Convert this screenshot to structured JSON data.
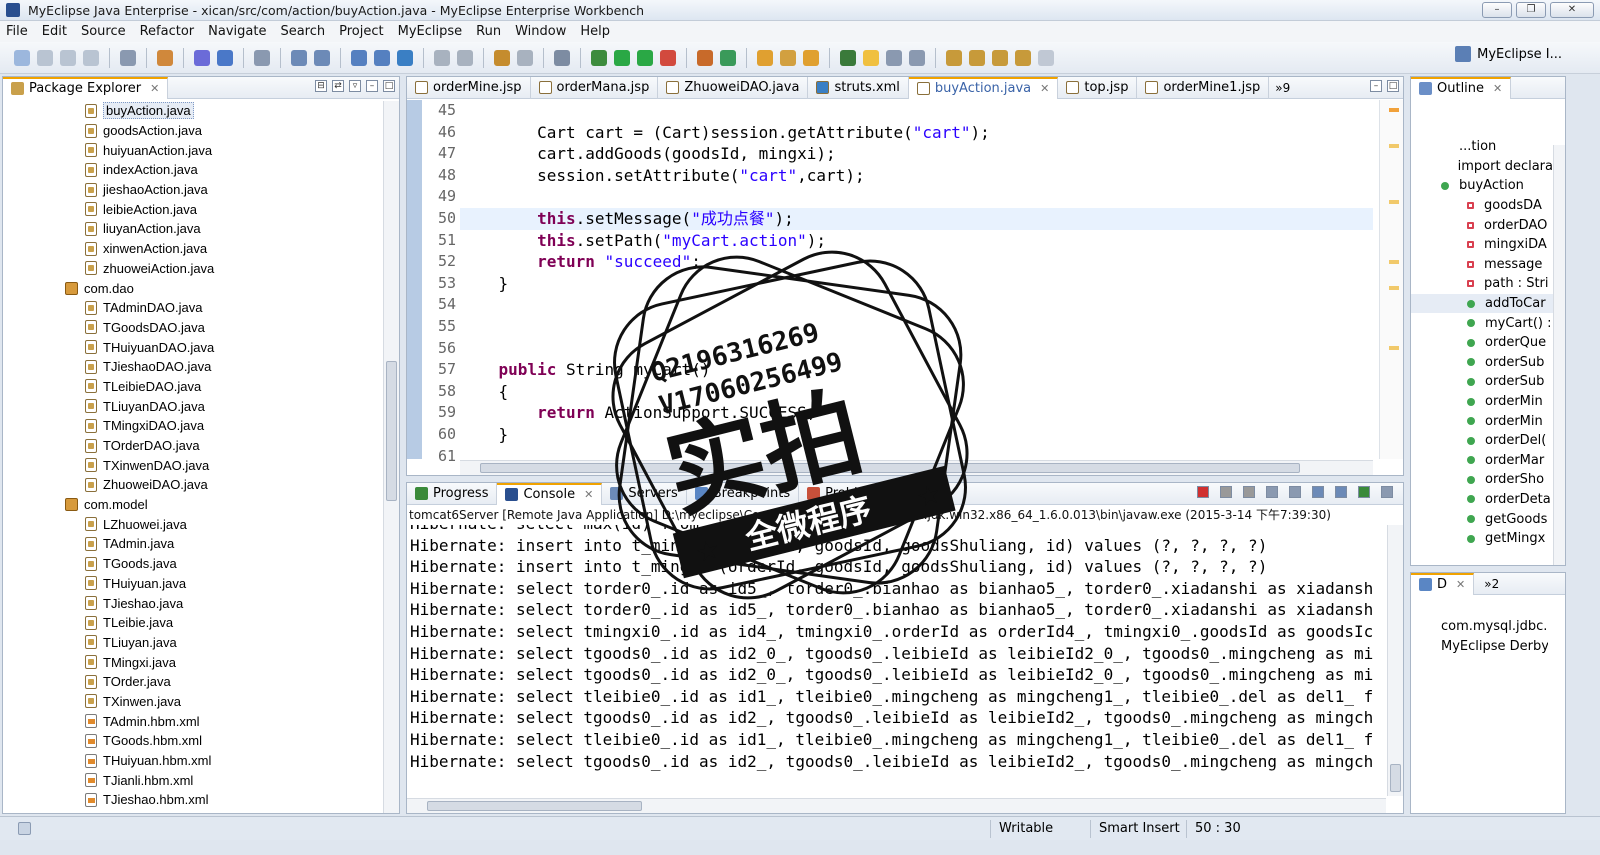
{
  "window": {
    "title": "MyEclipse Java Enterprise - xican/src/com/action/buyAction.java - MyEclipse Enterprise Workbench"
  },
  "menu": [
    "File",
    "Edit",
    "Source",
    "Refactor",
    "Navigate",
    "Search",
    "Project",
    "MyEclipse",
    "Run",
    "Window",
    "Help"
  ],
  "perspective": {
    "label": "MyEclipse I..."
  },
  "package_explorer": {
    "title": "Package Explorer",
    "items": [
      {
        "label": "buyAction.java",
        "type": "java",
        "indent": 2,
        "selected": true
      },
      {
        "label": "goodsAction.java",
        "type": "java",
        "indent": 2
      },
      {
        "label": "huiyuanAction.java",
        "type": "java",
        "indent": 2
      },
      {
        "label": "indexAction.java",
        "type": "java",
        "indent": 2
      },
      {
        "label": "jieshaoAction.java",
        "type": "java",
        "indent": 2
      },
      {
        "label": "leibieAction.java",
        "type": "java",
        "indent": 2
      },
      {
        "label": "liuyanAction.java",
        "type": "java",
        "indent": 2
      },
      {
        "label": "xinwenAction.java",
        "type": "java",
        "indent": 2
      },
      {
        "label": "zhuoweiAction.java",
        "type": "java",
        "indent": 2
      },
      {
        "label": "com.dao",
        "type": "pkg",
        "indent": 1
      },
      {
        "label": "TAdminDAO.java",
        "type": "java",
        "indent": 2
      },
      {
        "label": "TGoodsDAO.java",
        "type": "java",
        "indent": 2
      },
      {
        "label": "THuiyuanDAO.java",
        "type": "java",
        "indent": 2
      },
      {
        "label": "TJieshaoDAO.java",
        "type": "java",
        "indent": 2
      },
      {
        "label": "TLeibieDAO.java",
        "type": "java",
        "indent": 2
      },
      {
        "label": "TLiuyanDAO.java",
        "type": "java",
        "indent": 2
      },
      {
        "label": "TMingxiDAO.java",
        "type": "java",
        "indent": 2
      },
      {
        "label": "TOrderDAO.java",
        "type": "java",
        "indent": 2
      },
      {
        "label": "TXinwenDAO.java",
        "type": "java",
        "indent": 2
      },
      {
        "label": "ZhuoweiDAO.java",
        "type": "java",
        "indent": 2
      },
      {
        "label": "com.model",
        "type": "pkg",
        "indent": 1
      },
      {
        "label": "LZhuowei.java",
        "type": "java",
        "indent": 2
      },
      {
        "label": "TAdmin.java",
        "type": "java",
        "indent": 2
      },
      {
        "label": "TGoods.java",
        "type": "java",
        "indent": 2
      },
      {
        "label": "THuiyuan.java",
        "type": "java",
        "indent": 2
      },
      {
        "label": "TJieshao.java",
        "type": "java",
        "indent": 2
      },
      {
        "label": "TLeibie.java",
        "type": "java",
        "indent": 2
      },
      {
        "label": "TLiuyan.java",
        "type": "java",
        "indent": 2
      },
      {
        "label": "TMingxi.java",
        "type": "java",
        "indent": 2
      },
      {
        "label": "TOrder.java",
        "type": "java",
        "indent": 2
      },
      {
        "label": "TXinwen.java",
        "type": "java",
        "indent": 2
      },
      {
        "label": "TAdmin.hbm.xml",
        "type": "xml",
        "indent": 2
      },
      {
        "label": "TGoods.hbm.xml",
        "type": "xml",
        "indent": 2
      },
      {
        "label": "THuiyuan.hbm.xml",
        "type": "xml",
        "indent": 2
      },
      {
        "label": "TJianli.hbm.xml",
        "type": "xml",
        "indent": 2
      },
      {
        "label": "TJieshao.hbm.xml",
        "type": "xml",
        "indent": 2
      }
    ]
  },
  "editor": {
    "tabs": [
      {
        "label": "orderMine.jsp",
        "active": false
      },
      {
        "label": "orderMana.jsp",
        "active": false
      },
      {
        "label": "ZhuoweiDAO.java",
        "active": false
      },
      {
        "label": "struts.xml",
        "active": false
      },
      {
        "label": "buyAction.java",
        "active": true
      },
      {
        "label": "top.jsp",
        "active": false
      },
      {
        "label": "orderMine1.jsp",
        "active": false
      }
    ],
    "overflow_label": "»9",
    "current_line": 50,
    "lines": [
      {
        "n": "45",
        "code": ""
      },
      {
        "n": "46",
        "code": "        Cart cart = (Cart)session.getAttribute(\"cart\");"
      },
      {
        "n": "47",
        "code": "        cart.addGoods(goodsId, mingxi);"
      },
      {
        "n": "48",
        "code": "        session.setAttribute(\"cart\",cart);"
      },
      {
        "n": "49",
        "code": ""
      },
      {
        "n": "50",
        "code": "        this.setMessage(\"成功点餐\");"
      },
      {
        "n": "51",
        "code": "        this.setPath(\"myCart.action\");"
      },
      {
        "n": "52",
        "code": "        return \"succeed\";"
      },
      {
        "n": "53",
        "code": "    }"
      },
      {
        "n": "54",
        "code": ""
      },
      {
        "n": "55",
        "code": ""
      },
      {
        "n": "56",
        "code": ""
      },
      {
        "n": "57",
        "code": "    public String myCart()"
      },
      {
        "n": "58",
        "code": "    {"
      },
      {
        "n": "59",
        "code": "        return ActionSupport.SUCCESS;"
      },
      {
        "n": "60",
        "code": "    }"
      },
      {
        "n": "61",
        "code": ""
      }
    ]
  },
  "console": {
    "tabs": [
      {
        "label": "Progress",
        "active": false
      },
      {
        "label": "Console",
        "active": true
      },
      {
        "label": "Servers",
        "active": false
      },
      {
        "label": "Breakpoints",
        "active": false
      },
      {
        "label": "Problems",
        "active": false
      }
    ],
    "info": "tomcat6Server [Remote Java Application] D:\\myeclipse\\Common\\binary\\com.sun.java.jdk.win32.x86_64_1.6.0.013\\bin\\javaw.exe (2015-3-14 下午7:39:30)",
    "lines": [
      "Hibernate: select max(id) from ...",
      "Hibernate: insert into t_mingxi (orderId, goodsId, goodsShuliang, id) values (?, ?, ?, ?)",
      "Hibernate: insert into t_mingxi (orderId, goodsId, goodsShuliang, id) values (?, ?, ?, ?)",
      "Hibernate: select torder0_.id as id5_, torder0_.bianhao as bianhao5_, torder0_.xiadanshi as xiadansh",
      "Hibernate: select torder0_.id as id5_, torder0_.bianhao as bianhao5_, torder0_.xiadanshi as xiadansh",
      "Hibernate: select tmingxi0_.id as id4_, tmingxi0_.orderId as orderId4_, tmingxi0_.goodsId as goodsIc",
      "Hibernate: select tgoods0_.id as id2_0_, tgoods0_.leibieId as leibieId2_0_, tgoods0_.mingcheng as mi",
      "Hibernate: select tgoods0_.id as id2_0_, tgoods0_.leibieId as leibieId2_0_, tgoods0_.mingcheng as mi",
      "Hibernate: select tleibie0_.id as id1_, tleibie0_.mingcheng as mingcheng1_, tleibie0_.del as del1_ f",
      "Hibernate: select tgoods0_.id as id2_, tgoods0_.leibieId as leibieId2_, tgoods0_.mingcheng as mingch",
      "Hibernate: select tleibie0_.id as id1_, tleibie0_.mingcheng as mingcheng1_, tleibie0_.del as del1_ f",
      "Hibernate: select tgoods0_.id as id2_, tgoods0_.leibieId as leibieId2_, tgoods0_.mingcheng as mingch"
    ]
  },
  "outline": {
    "title": "Outline",
    "items": [
      {
        "label": "...tion",
        "kind": "none"
      },
      {
        "label": "import declara",
        "kind": "none"
      },
      {
        "label": "buyAction",
        "kind": "class"
      },
      {
        "label": "goodsDA",
        "kind": "field"
      },
      {
        "label": "orderDAO",
        "kind": "field"
      },
      {
        "label": "mingxiDA",
        "kind": "field"
      },
      {
        "label": "message",
        "kind": "field"
      },
      {
        "label": "path : Stri",
        "kind": "field"
      },
      {
        "label": "addToCar",
        "kind": "method"
      },
      {
        "label": "myCart() :",
        "kind": "method"
      },
      {
        "label": "orderQue",
        "kind": "method"
      },
      {
        "label": "orderSub",
        "kind": "method"
      },
      {
        "label": "orderSub",
        "kind": "method"
      },
      {
        "label": "orderMin",
        "kind": "method"
      },
      {
        "label": "orderMin",
        "kind": "method"
      },
      {
        "label": "orderDel(",
        "kind": "method"
      },
      {
        "label": "orderMar",
        "kind": "method"
      },
      {
        "label": "orderSho",
        "kind": "method"
      },
      {
        "label": "orderDeta",
        "kind": "method"
      },
      {
        "label": "getGoods",
        "kind": "method"
      },
      {
        "label": "getMingx",
        "kind": "method"
      }
    ]
  },
  "db_panel": {
    "tab_label": "D",
    "overflow_label": "»2",
    "items": [
      "com.mysql.jdbc.Dri",
      "MyEclipse Derby"
    ]
  },
  "status": {
    "writable": "Writable",
    "insert_mode": "Smart Insert",
    "position": "50 : 30"
  },
  "watermark": {
    "qq": "Q2196316269",
    "vx": "V17060256499",
    "main": "实拍",
    "ribbon": "全微程序"
  },
  "colors": {
    "keyword": "#7f0055",
    "string": "#2a00ff",
    "accent_tab": "#f0a200",
    "current_line": "#e8f2fe"
  }
}
